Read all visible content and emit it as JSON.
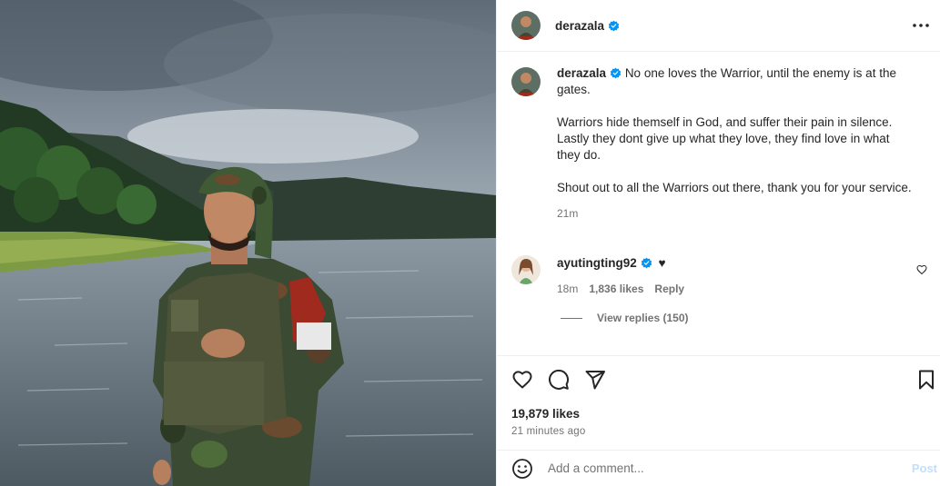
{
  "post": {
    "author": "derazala",
    "verified": true
  },
  "caption": {
    "author": "derazala",
    "paragraphs": [
      "No one loves the Warrior, until the enemy is at the gates.",
      "Warriors hide themself in God, and suffer their pain in silence. Lastly they dont give up what they love, they find love in what they do.",
      "Shout out to all the Warriors out there, thank you for your service."
    ],
    "time": "21m"
  },
  "comment": {
    "author": "ayutingting92",
    "emoji": "♥",
    "time": "18m",
    "likes": "1,836 likes",
    "reply_label": "Reply",
    "view_replies": "View replies (150)"
  },
  "stats": {
    "likes": "19,879 likes",
    "time_ago": "21 minutes ago"
  },
  "composer": {
    "placeholder": "Add a comment...",
    "post_label": "Post"
  },
  "icons": {
    "verified": "verified-badge-icon",
    "more": "more-options-icon",
    "like": "heart-icon",
    "comment": "comment-icon",
    "share": "share-icon",
    "save": "bookmark-icon",
    "emoji": "emoji-icon"
  },
  "colors": {
    "verified": "#0095f6",
    "post_button": "#c0dffd",
    "muted_text": "#737373"
  }
}
